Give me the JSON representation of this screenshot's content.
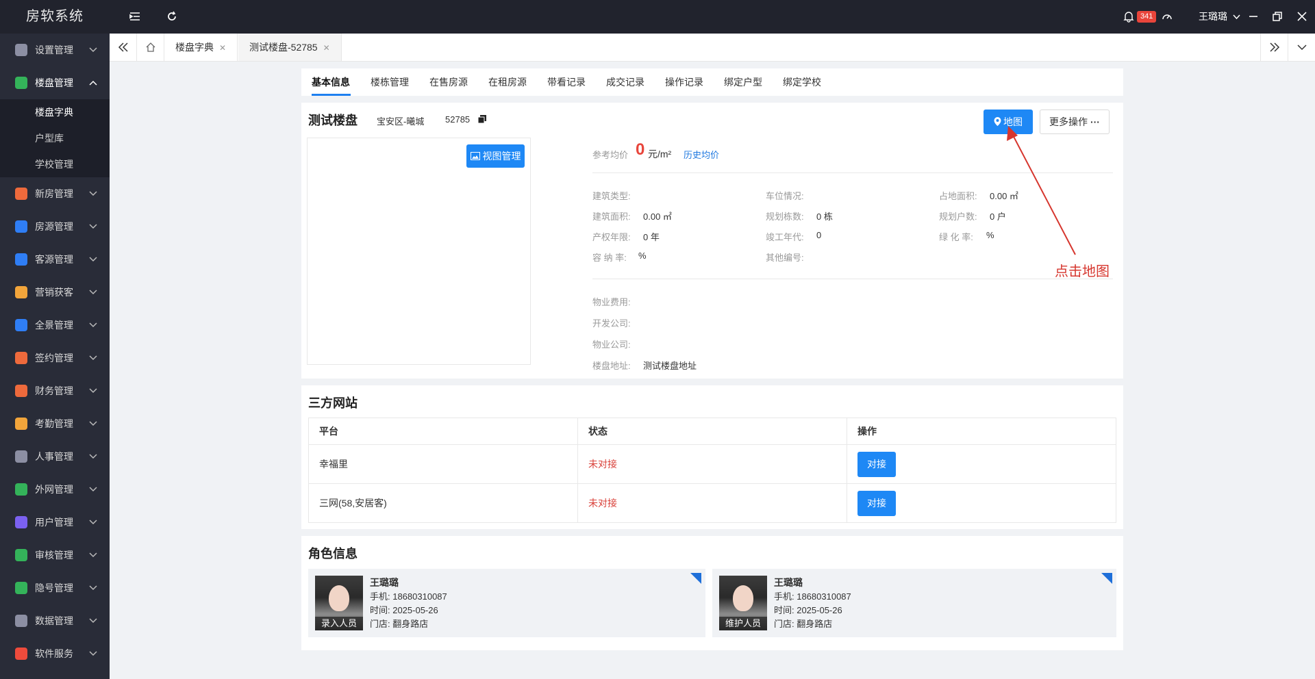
{
  "app": {
    "brand": "房软系统"
  },
  "topbar": {
    "notification_count": "341",
    "user_name": "王璐璐"
  },
  "sidebar": {
    "items": [
      {
        "label": "设置管理",
        "icon": "gear-icon",
        "color": "#8c8fa3"
      },
      {
        "label": "楼盘管理",
        "icon": "building-icon",
        "color": "#34b35a"
      },
      {
        "label": "新房管理",
        "icon": "house-icon",
        "color": "#ee6a3c"
      },
      {
        "label": "房源管理",
        "icon": "home-icon",
        "color": "#2f7ef5"
      },
      {
        "label": "客源管理",
        "icon": "customer-icon",
        "color": "#2f7ef5"
      },
      {
        "label": "营销获客",
        "icon": "share-icon",
        "color": "#f2a53b"
      },
      {
        "label": "全景管理",
        "icon": "panorama-icon",
        "color": "#2f7ef5"
      },
      {
        "label": "签约管理",
        "icon": "contract-icon",
        "color": "#ee6a3c"
      },
      {
        "label": "财务管理",
        "icon": "finance-icon",
        "color": "#ee6a3c"
      },
      {
        "label": "考勤管理",
        "icon": "attendance-icon",
        "color": "#f2a53b"
      },
      {
        "label": "人事管理",
        "icon": "org-icon",
        "color": "#8c8fa3"
      },
      {
        "label": "外网管理",
        "icon": "web-icon",
        "color": "#34b35a"
      },
      {
        "label": "用户管理",
        "icon": "user-icon",
        "color": "#7b61f0"
      },
      {
        "label": "审核管理",
        "icon": "audit-icon",
        "color": "#34b35a"
      },
      {
        "label": "隐号管理",
        "icon": "phone-icon",
        "color": "#34b35a"
      },
      {
        "label": "数据管理",
        "icon": "database-icon",
        "color": "#8c8fa3"
      },
      {
        "label": "软件服务",
        "icon": "alert-icon",
        "color": "#ee4b3c"
      }
    ],
    "sub_items": [
      "楼盘字典",
      "户型库",
      "学校管理"
    ]
  },
  "tabs": [
    {
      "label": "楼盘字典"
    },
    {
      "label": "测试楼盘-52785"
    }
  ],
  "subtabs": [
    "基本信息",
    "楼栋管理",
    "在售房源",
    "在租房源",
    "带看记录",
    "成交记录",
    "操作记录",
    "绑定户型",
    "绑定学校"
  ],
  "estate": {
    "name": "测试楼盘",
    "district": "宝安区-曦城",
    "id": "52785",
    "map_button": "地图",
    "more_button": "更多操作",
    "view_manage_button": "视图管理",
    "avg_price_label": "参考均价",
    "avg_price_value": "0",
    "avg_price_unit": "元/m²",
    "history_price_link": "历史均价",
    "fields": [
      {
        "label": "建筑类型:",
        "value": ""
      },
      {
        "label": "车位情况:",
        "value": ""
      },
      {
        "label": "占地面积:",
        "value": "0.00 ㎡"
      },
      {
        "label": "建筑面积:",
        "value": "0.00 ㎡"
      },
      {
        "label": "规划栋数:",
        "value": "0 栋"
      },
      {
        "label": "规划户数:",
        "value": "0 户"
      },
      {
        "label": "产权年限:",
        "value": "0 年"
      },
      {
        "label": "竣工年代:",
        "value": "0"
      },
      {
        "label": "绿 化 率:",
        "value": "%"
      },
      {
        "label": "容 纳 率:",
        "value": "%"
      },
      {
        "label": "其他编号:",
        "value": ""
      }
    ],
    "extra_fields": [
      {
        "label": "物业费用:",
        "value": ""
      },
      {
        "label": "开发公司:",
        "value": ""
      },
      {
        "label": "物业公司:",
        "value": ""
      },
      {
        "label": "楼盘地址:",
        "value": "测试楼盘地址"
      }
    ]
  },
  "annotation": "点击地图",
  "third_party": {
    "title": "三方网站",
    "headers": [
      "平台",
      "状态",
      "操作"
    ],
    "rows": [
      {
        "platform": "幸福里",
        "status": "未对接",
        "action": "对接"
      },
      {
        "platform": "三网(58,安居客)",
        "status": "未对接",
        "action": "对接"
      }
    ]
  },
  "roles": {
    "title": "角色信息",
    "cards": [
      {
        "tag": "录入人员",
        "name": "王璐璐",
        "phone": "手机: 18680310087",
        "time": "时间: 2025-05-26",
        "store": "门店: 翻身路店"
      },
      {
        "tag": "维护人员",
        "name": "王璐璐",
        "phone": "手机: 18680310087",
        "time": "时间: 2025-05-26",
        "store": "门店: 翻身路店"
      }
    ]
  }
}
